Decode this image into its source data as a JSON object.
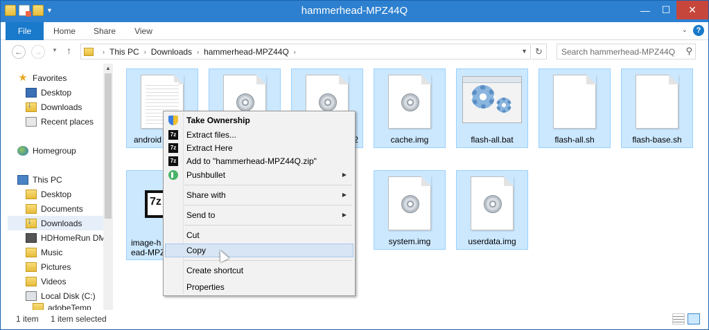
{
  "window": {
    "title": "hammerhead-MPZ44Q",
    "controls": {
      "minimize": "—",
      "maximize": "☐",
      "close": "✕"
    }
  },
  "ribbon": {
    "tabs": [
      "File",
      "Home",
      "Share",
      "View"
    ],
    "help": "?"
  },
  "address": {
    "crumbs": [
      "This PC",
      "Downloads",
      "hammerhead-MPZ44Q"
    ],
    "search_placeholder": "Search hammerhead-MPZ44Q"
  },
  "sidebar": {
    "items": [
      {
        "label": "Favorites",
        "icon": "star-icon"
      },
      {
        "label": "Desktop",
        "icon": "desktop-icon"
      },
      {
        "label": "Downloads",
        "icon": "downloads-icon"
      },
      {
        "label": "Recent places",
        "icon": "recent-places-icon"
      },
      {
        "label": "Homegroup",
        "icon": "homegroup-icon"
      },
      {
        "label": "This PC",
        "icon": "computer-icon"
      },
      {
        "label": "Desktop",
        "icon": "desktop-icon"
      },
      {
        "label": "Documents",
        "icon": "folder-icon"
      },
      {
        "label": "Downloads",
        "icon": "downloads-icon",
        "selected": true
      },
      {
        "label": "HDHomeRun DM",
        "icon": "device-icon"
      },
      {
        "label": "Music",
        "icon": "music-folder-icon"
      },
      {
        "label": "Pictures",
        "icon": "folder-icon"
      },
      {
        "label": "Videos",
        "icon": "folder-icon"
      },
      {
        "label": "Local Disk (C:)",
        "icon": "disk-icon"
      },
      {
        "label": "adobeTemp",
        "icon": "folder-icon"
      }
    ]
  },
  "files": [
    {
      "name": "android",
      "type": "text"
    },
    {
      "name": "",
      "type": "disc-image"
    },
    {
      "name": "2",
      "type": "disc-image"
    },
    {
      "name": "cache.img",
      "type": "disc-image"
    },
    {
      "name": "flash-all.bat",
      "type": "batch"
    },
    {
      "name": "flash-all.sh",
      "type": "blank"
    },
    {
      "name": "flash-base.sh",
      "type": "blank"
    },
    {
      "name": "image-h\nead-MPZ",
      "type": "archive-7z"
    },
    {
      "name": "system.img",
      "type": "disc-image"
    },
    {
      "name": "userdata.img",
      "type": "disc-image"
    }
  ],
  "context_menu": {
    "items": [
      {
        "label": "Take Ownership",
        "icon": "shield-icon",
        "bold": true
      },
      {
        "label": "Extract files...",
        "icon": "7zip-icon"
      },
      {
        "label": "Extract Here",
        "icon": "7zip-icon"
      },
      {
        "label": "Add to \"hammerhead-MPZ44Q.zip\"",
        "icon": "7zip-icon"
      },
      {
        "label": "Pushbullet",
        "icon": "pushbullet-icon",
        "submenu": true
      },
      {
        "label": "Share with",
        "submenu": true
      },
      {
        "label": "Send to",
        "submenu": true
      },
      {
        "label": "Cut"
      },
      {
        "label": "Copy",
        "hovered": true
      },
      {
        "label": "Create shortcut"
      },
      {
        "label": "Properties"
      }
    ]
  },
  "status": {
    "count": "1 item",
    "selection": "1 item selected"
  }
}
